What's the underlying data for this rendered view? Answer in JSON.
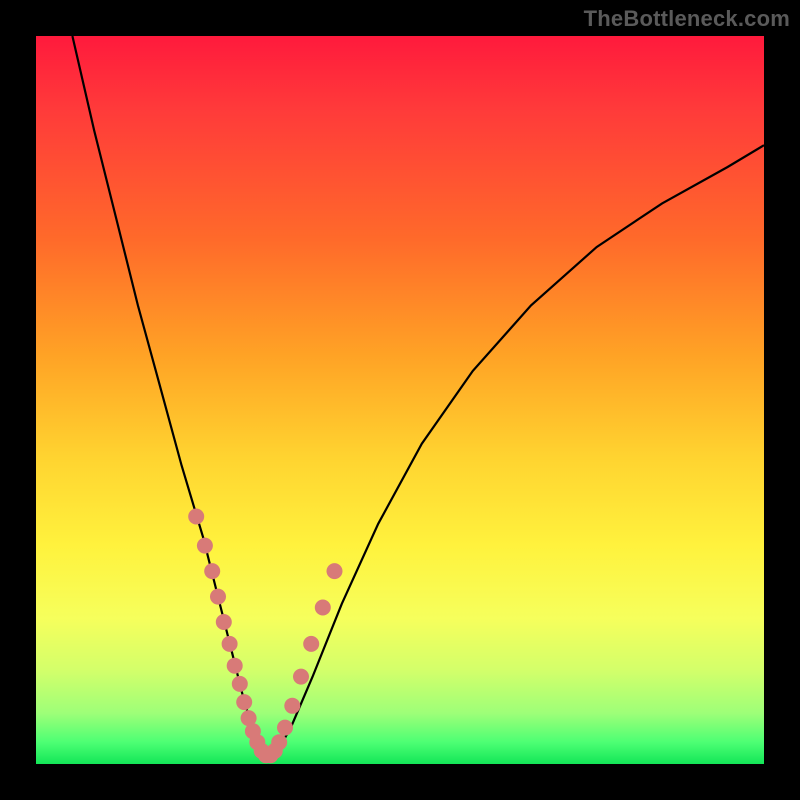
{
  "watermark": "TheBottleneck.com",
  "chart_data": {
    "type": "line",
    "title": "",
    "xlabel": "",
    "ylabel": "",
    "xlim": [
      0,
      100
    ],
    "ylim": [
      0,
      100
    ],
    "curve": {
      "x": [
        5,
        8,
        11,
        14,
        17,
        20,
        23,
        25,
        27,
        28.5,
        30,
        31,
        32,
        33,
        35,
        38,
        42,
        47,
        53,
        60,
        68,
        77,
        86,
        95,
        100
      ],
      "y": [
        100,
        87,
        75,
        63,
        52,
        41,
        31,
        23,
        15,
        9,
        4,
        1.5,
        0.5,
        1.5,
        5,
        12,
        22,
        33,
        44,
        54,
        63,
        71,
        77,
        82,
        85
      ]
    },
    "highlight_points": {
      "x": [
        22,
        23.2,
        24.2,
        25,
        25.8,
        26.6,
        27.3,
        28,
        28.6,
        29.2,
        29.8,
        30.4,
        31,
        31.6,
        32.2,
        32.8,
        33.4,
        34.2,
        35.2,
        36.4,
        37.8,
        39.4,
        41
      ],
      "y": [
        34,
        30,
        26.5,
        23,
        19.5,
        16.5,
        13.5,
        11,
        8.5,
        6.3,
        4.5,
        3,
        1.8,
        1.2,
        1.2,
        1.8,
        3,
        5,
        8,
        12,
        16.5,
        21.5,
        26.5
      ]
    },
    "gradient_stops": [
      {
        "pos": 0,
        "color": "#ff1a3c"
      },
      {
        "pos": 28,
        "color": "#ff6a2a"
      },
      {
        "pos": 58,
        "color": "#ffd430"
      },
      {
        "pos": 80,
        "color": "#f6ff5c"
      },
      {
        "pos": 100,
        "color": "#13e657"
      }
    ]
  }
}
